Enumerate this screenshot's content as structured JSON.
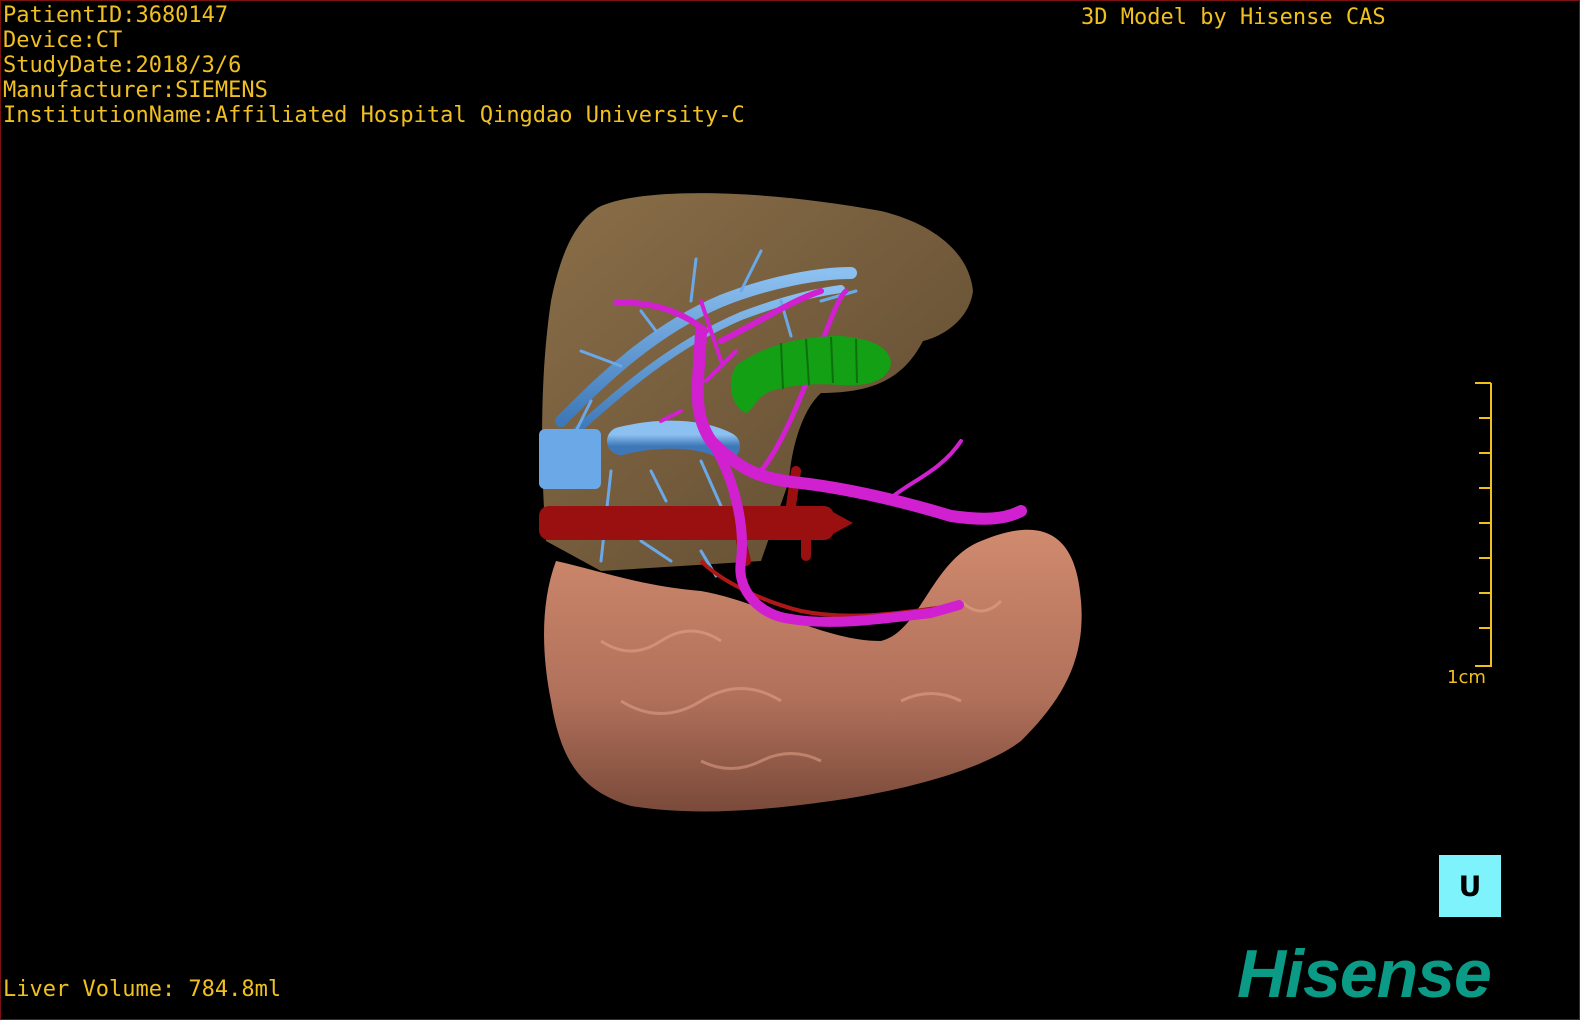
{
  "overlay": {
    "patient_id": "PatientID:3680147",
    "device": "Device:CT",
    "study_date": "StudyDate:2018/3/6",
    "manufacturer": "Manufacturer:SIEMENS",
    "institution": "InstitutionName:Affiliated Hospital Qingdao University-C",
    "credit": "3D Model by Hisense CAS",
    "volume": "Liver Volume: 784.8ml"
  },
  "scale": {
    "label": "1cm"
  },
  "orientation_cube": {
    "face": "ᑌ"
  },
  "brand": {
    "logo_text": "Hisense"
  },
  "colors": {
    "text": "#f0c020",
    "liver_upper": "#7a6040",
    "liver_lower": "#c07a60",
    "portal_vein": "#d020d0",
    "hepatic_vein": "#5a96d8",
    "artery": "#a01010",
    "lesion": "#12a012",
    "orientation_cube": "#7ff3fb",
    "logo": "#0a9a86",
    "border": "#7a1010"
  }
}
